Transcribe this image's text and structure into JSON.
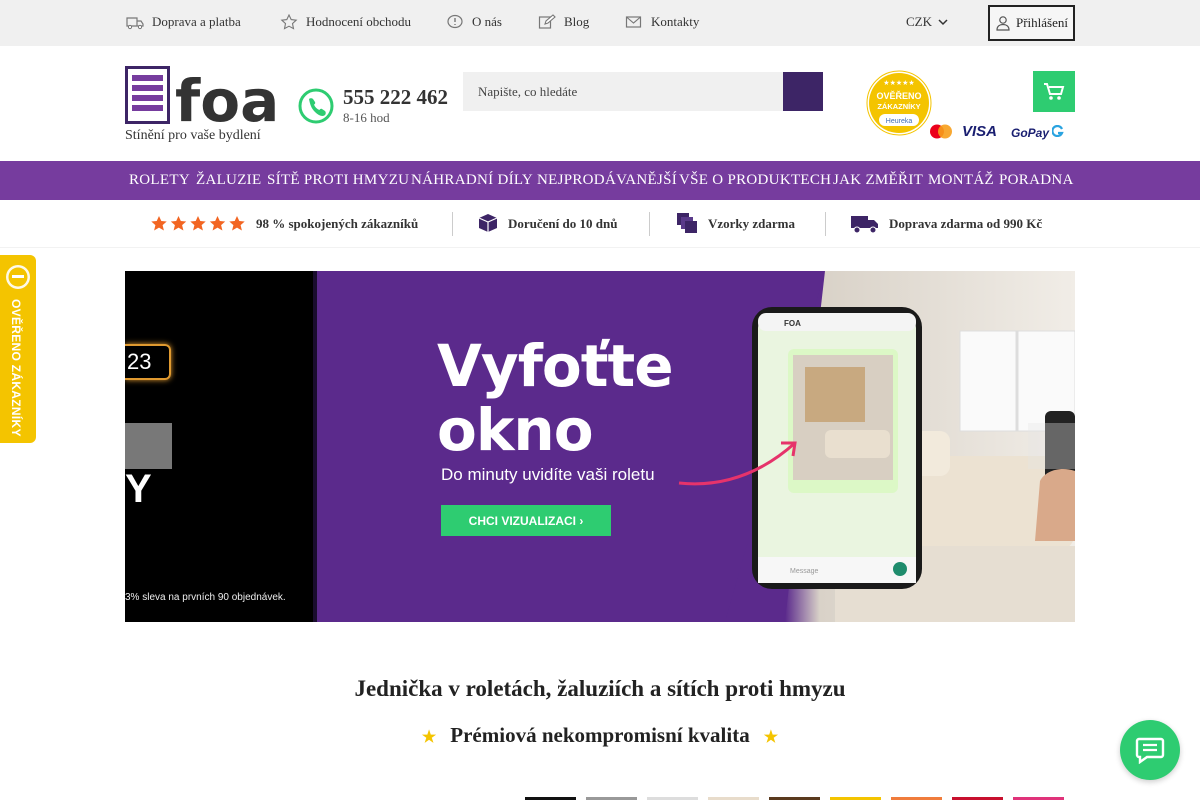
{
  "topbar": {
    "links": [
      {
        "label": "Doprava a platba",
        "icon": "truck-icon"
      },
      {
        "label": "Hodnocení obchodu",
        "icon": "star-outline-icon"
      },
      {
        "label": "O nás",
        "icon": "info-bubble-icon"
      },
      {
        "label": "Blog",
        "icon": "edit-icon"
      },
      {
        "label": "Kontakty",
        "icon": "mail-icon"
      }
    ],
    "currency": "CZK",
    "login": "Přihlášení"
  },
  "header": {
    "logo_text": "foa",
    "tagline": "Stínění pro vaše bydlení",
    "phone": "555 222 462",
    "hours": "8-16 hod",
    "search_placeholder": "Napište, co hledáte",
    "badge": {
      "line1": "OVĚŘENO",
      "line2": "ZÁKAZNÍKY",
      "brand": "Heureka"
    },
    "payments": [
      "VISA",
      "GoPay"
    ]
  },
  "nav": [
    "ROLETY",
    "ŽALUZIE",
    "SÍTĚ PROTI HMYZU",
    "NÁHRADNÍ DÍLY",
    "NEJPRODÁVANĚJŠÍ",
    "VŠE O PRODUKTECH",
    "JAK ZMĚŘIT",
    "MONTÁŽ",
    "PORADNA"
  ],
  "benefits": [
    {
      "label": "98 % spokojených zákazníků",
      "icon": "five-stars-icon"
    },
    {
      "label": "Doručení do 10 dnů",
      "icon": "box-icon"
    },
    {
      "label": "Vzorky zdarma",
      "icon": "samples-icon"
    },
    {
      "label": "Doprava zdarma od 990 Kč",
      "icon": "delivery-truck-icon"
    }
  ],
  "sidetab": "OVĚŘENO ZÁKAZNÍKY",
  "banner": {
    "headline1": "Vyfoťte",
    "headline2": "okno",
    "subtitle": "Do minuty uvidíte vaši roletu",
    "cta": "CHCI VIZUALIZACI ›",
    "promo_code": "23",
    "promo_letter": "Y",
    "promo_note": "3% sleva na prvních 90 objednávek.",
    "phone_app": "FOA",
    "phone_message_placeholder": "Message"
  },
  "headline": "Jednička v roletách, žaluziích a sítích proti hmyzu",
  "subline": "Prémiová nekompromisní kvalita",
  "colors": {
    "brand_purple": "#763c9e",
    "dark_purple": "#3d2566",
    "accent_green": "#2ecc71",
    "star_orange": "#f26522",
    "badge_yellow": "#f4c400"
  },
  "swatch_colors": [
    "#111111",
    "#999999",
    "#dddddd",
    "#e8dccb",
    "#5a3a1e",
    "#f4c400",
    "#f07c3c",
    "#c8102e",
    "#e0337a"
  ]
}
